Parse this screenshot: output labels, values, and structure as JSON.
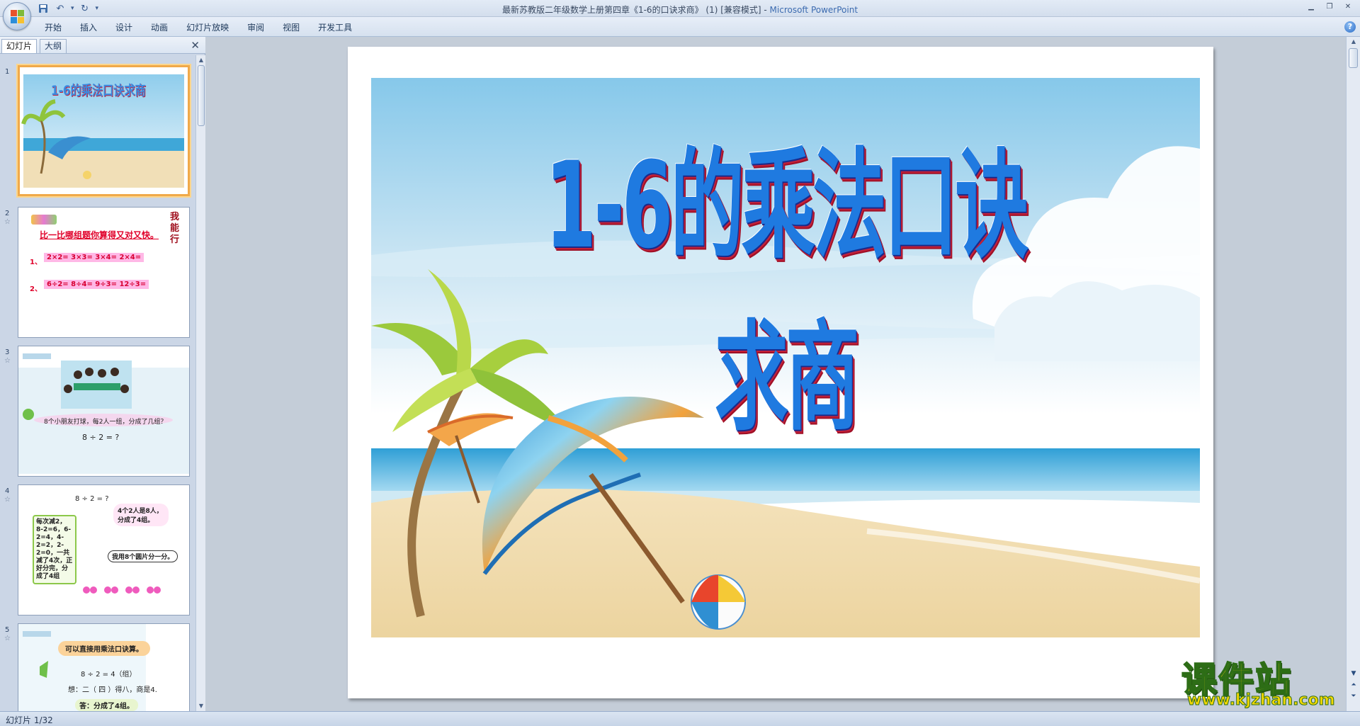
{
  "window": {
    "title": "最新苏教版二年级数学上册第四章《1-6的口诀求商》 (1) [兼容模式] - ",
    "app_name": "Microsoft PowerPoint"
  },
  "ribbon": {
    "tabs": [
      "开始",
      "插入",
      "设计",
      "动画",
      "幻灯片放映",
      "审阅",
      "视图",
      "开发工具"
    ]
  },
  "panel": {
    "tab_slides": "幻灯片",
    "tab_outline": "大纲"
  },
  "thumbnails": [
    {
      "number": "1",
      "title": "1-6的乘法口诀求商"
    },
    {
      "number": "2",
      "heading": "比一比哪组题你算得又对又快。",
      "side": "我能行",
      "row1_label": "1、",
      "row1": "2×2=    3×3=    3×4=    2×4=",
      "row2_label": "2、",
      "row2": "6÷2=    8÷4=    9÷3=    12÷3="
    },
    {
      "number": "3",
      "caption": "8个小朋友打球，每2人一组，分成了几组？",
      "equation": "8 ÷ 2 = ?"
    },
    {
      "number": "4",
      "equation": "8 ÷ 2 = ?",
      "bubble1": "4个2人是8人，分成了4组。",
      "steps": "每次减2，8-2=6，6-2=4，4-2=2，2-2=0，一共减了4次，正好分完，分成了4组",
      "bubble2": "我用8个圆片分一分。"
    },
    {
      "number": "5",
      "bubble": "可以直接用乘法口诀算。",
      "equation": "8 ÷ 2 =  4（组）",
      "line2": "想：二（ 四 ）得八，商是4.",
      "answer": "答：分成了4组。"
    }
  ],
  "slide": {
    "title": "1-6的乘法口诀求商"
  },
  "status": {
    "slide_indicator": "幻灯片 1/32"
  },
  "watermark": {
    "main": "课件站",
    "url": "www.kjzhan.com"
  }
}
